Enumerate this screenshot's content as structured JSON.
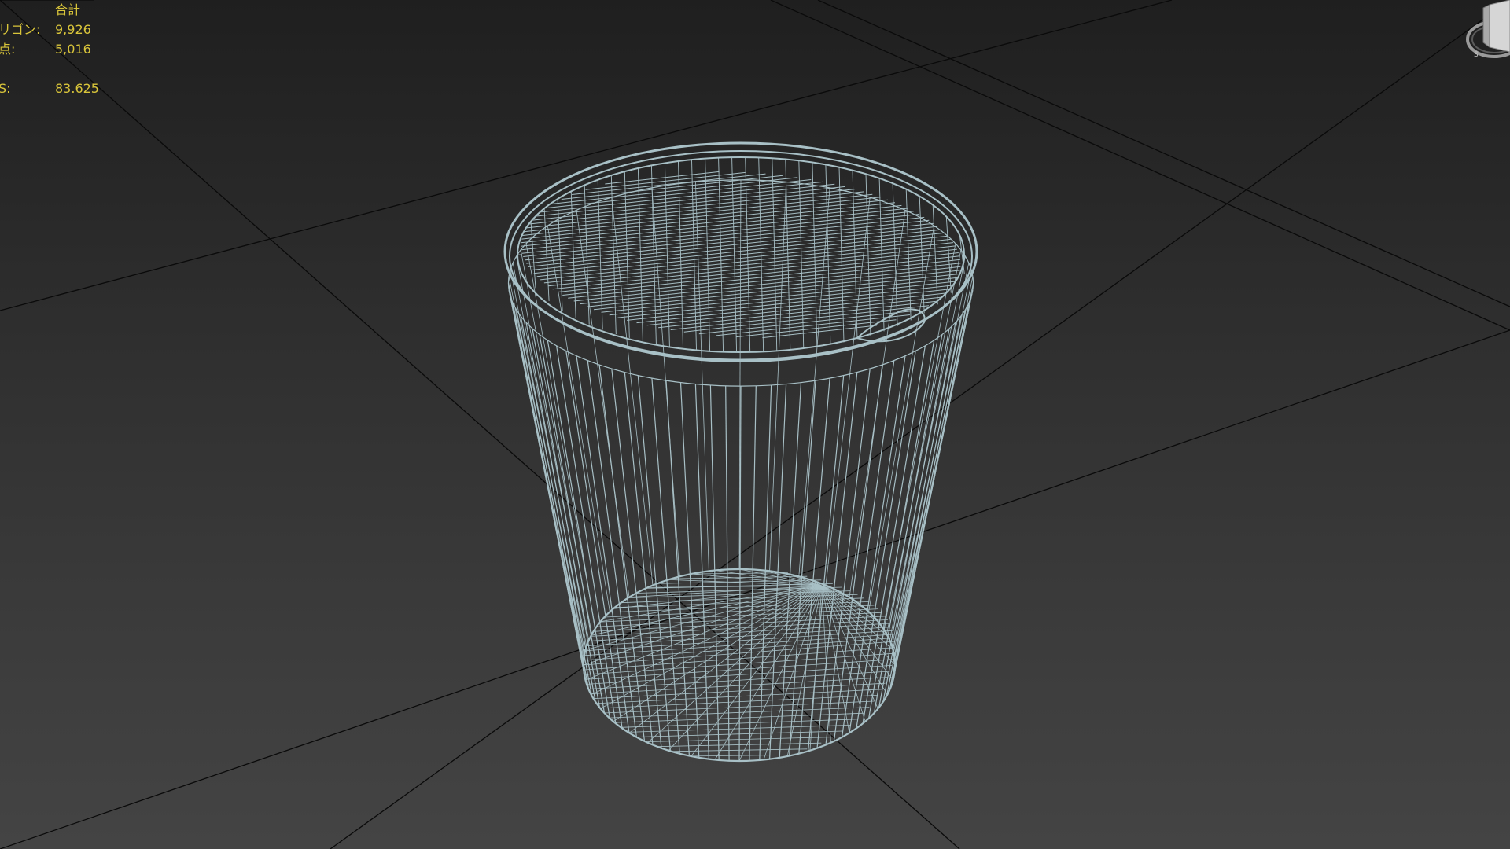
{
  "viewport": {
    "background_top": "#1f1f1f",
    "background_bottom": "#444444",
    "grid_line_color": "#0a0a0a",
    "wire_color": "#a8c0c6"
  },
  "stats": {
    "header": "合計",
    "rows": [
      {
        "label": "リゴン:",
        "value": "9,926"
      },
      {
        "label": "点:",
        "value": "5,016"
      },
      {
        "label": "S:",
        "value": "83.625"
      }
    ],
    "color": "#d9c53a"
  },
  "viewcube": {
    "icon": "viewcube-icon"
  },
  "model": {
    "icon": "wireframe-cup-icon"
  }
}
